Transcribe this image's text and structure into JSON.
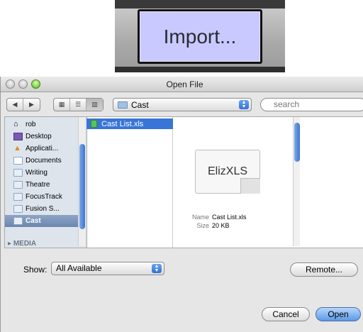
{
  "import_button": {
    "label": "Import..."
  },
  "window": {
    "title": "Open File",
    "path_popup": "Cast",
    "search_placeholder": "search"
  },
  "sidebar": {
    "items": [
      {
        "label": "rob"
      },
      {
        "label": "Desktop"
      },
      {
        "label": "Applicati..."
      },
      {
        "label": "Documents"
      },
      {
        "label": "Writing"
      },
      {
        "label": "Theatre"
      },
      {
        "label": "FocusTrack"
      },
      {
        "label": "Fusion S..."
      },
      {
        "label": "Cast",
        "selected": true
      }
    ],
    "section_media": "MEDIA"
  },
  "file_list": {
    "selected_file": "Cast List.xls"
  },
  "preview": {
    "icon_text": "ElizXLS",
    "name_label": "Name",
    "name_value": "Cast List.xls",
    "size_label": "Size",
    "size_value": "20 KB"
  },
  "footer": {
    "show_label": "Show:",
    "show_value": "All Available",
    "remote_label": "Remote...",
    "cancel_label": "Cancel",
    "open_label": "Open"
  },
  "colors": {
    "import_bg": "#c9c9ff",
    "selection": "#3875d7",
    "accent": "#3a76d0"
  }
}
